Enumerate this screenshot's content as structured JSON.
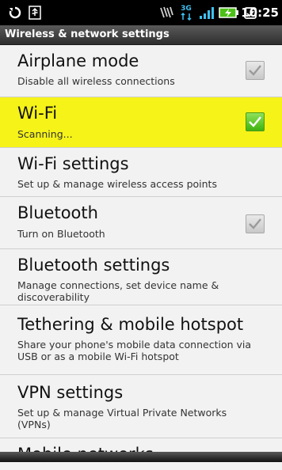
{
  "status_bar": {
    "time": "10:25",
    "network_type": "3G",
    "icons": [
      "sync-icon",
      "usb-icon",
      "vibrate-icon",
      "3g-data-icon",
      "signal-icon",
      "battery-charging-icon",
      "alarm-icon"
    ]
  },
  "title": "Wireless & network settings",
  "items": [
    {
      "title": "Airplane mode",
      "summary": "Disable all wireless connections",
      "checkbox": true,
      "checked": false
    },
    {
      "title": "Wi-Fi",
      "summary": "Scanning...",
      "checkbox": true,
      "checked": true,
      "highlighted": true
    },
    {
      "title": "Wi-Fi settings",
      "summary": "Set up & manage wireless access points",
      "checkbox": false
    },
    {
      "title": "Bluetooth",
      "summary": "Turn on Bluetooth",
      "checkbox": true,
      "checked": false
    },
    {
      "title": "Bluetooth settings",
      "summary": "Manage connections, set device name & discoverability",
      "checkbox": false
    },
    {
      "title": "Tethering & mobile hotspot",
      "summary": "Share your phone's mobile data connection via USB or as a mobile Wi-Fi hotspot",
      "checkbox": false
    },
    {
      "title": "VPN settings",
      "summary": "Set up & manage Virtual Private Networks (VPNs)",
      "checkbox": false
    },
    {
      "title": "Mobile networks",
      "summary": "",
      "checkbox": false
    }
  ],
  "colors": {
    "highlight": "#f6f318",
    "checkbox_on": "#3fb30f",
    "background": "#f2f2f2"
  }
}
